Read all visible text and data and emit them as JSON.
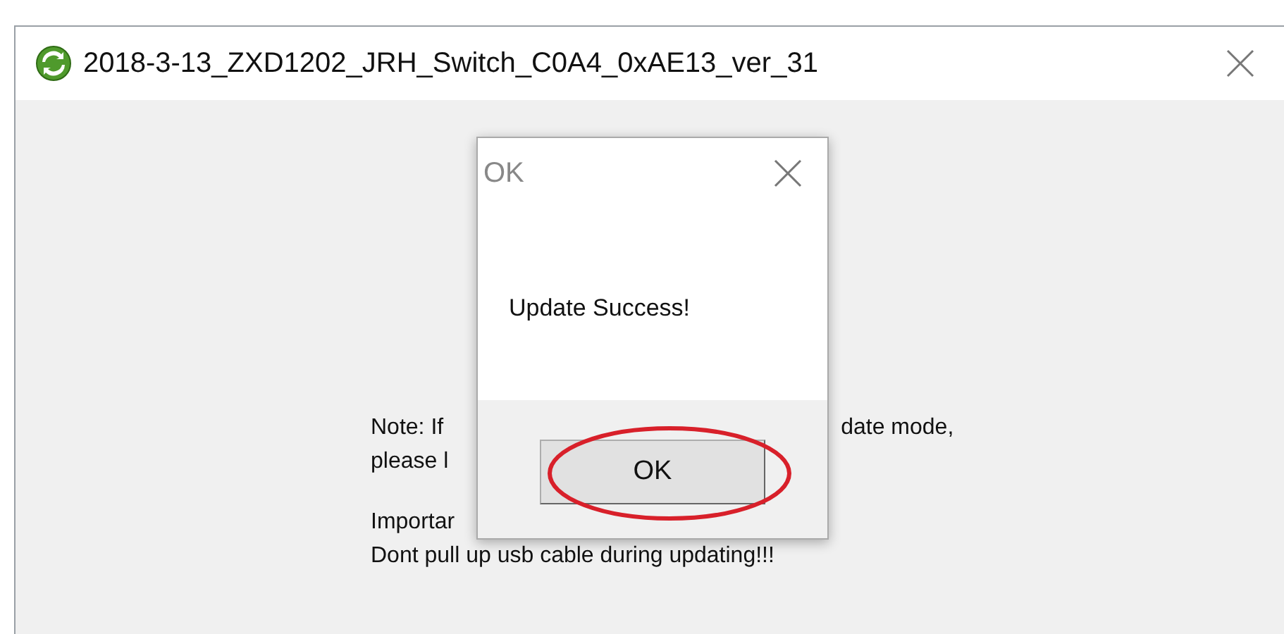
{
  "window": {
    "title": "2018-3-13_ZXD1202_JRH_Switch_C0A4_0xAE13_ver_31"
  },
  "background_text": [
    {
      "left": "Note: If",
      "right": "date mode,"
    },
    {
      "left": "please l"
    },
    {
      "left": "Importar"
    },
    {
      "left": "Dont pull up usb cable during updating!!!"
    }
  ],
  "dialog": {
    "title": "OK",
    "message": "Update Success!",
    "button": "OK"
  }
}
